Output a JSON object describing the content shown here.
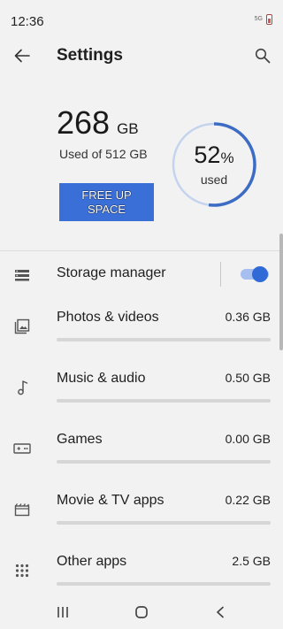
{
  "status_bar": {
    "time": "12:36",
    "network": "5G"
  },
  "app_bar": {
    "title": "Settings"
  },
  "summary": {
    "used_amount": "268",
    "used_unit": "GB",
    "used_of": "Used of 512 GB",
    "free_button": "FREE UP SPACE",
    "percent_value": "52",
    "percent_sign": "%",
    "percent_caption": "used",
    "percent_fraction": 0.52
  },
  "storage_manager": {
    "label": "Storage manager",
    "enabled": true
  },
  "categories": [
    {
      "label": "Photos & videos",
      "size": "0.36 GB",
      "icon": "photo-icon"
    },
    {
      "label": "Music & audio",
      "size": "0.50 GB",
      "icon": "music-note-icon"
    },
    {
      "label": "Games",
      "size": "0.00 GB",
      "icon": "gamepad-icon"
    },
    {
      "label": "Movie & TV apps",
      "size": "0.22 GB",
      "icon": "clapperboard-icon"
    },
    {
      "label": "Other apps",
      "size": "2.5 GB",
      "icon": "apps-grid-icon"
    }
  ],
  "colors": {
    "accent": "#3a6fd8",
    "gauge_fill": "#3d6cc4",
    "gauge_track": "#c5d4ee"
  }
}
